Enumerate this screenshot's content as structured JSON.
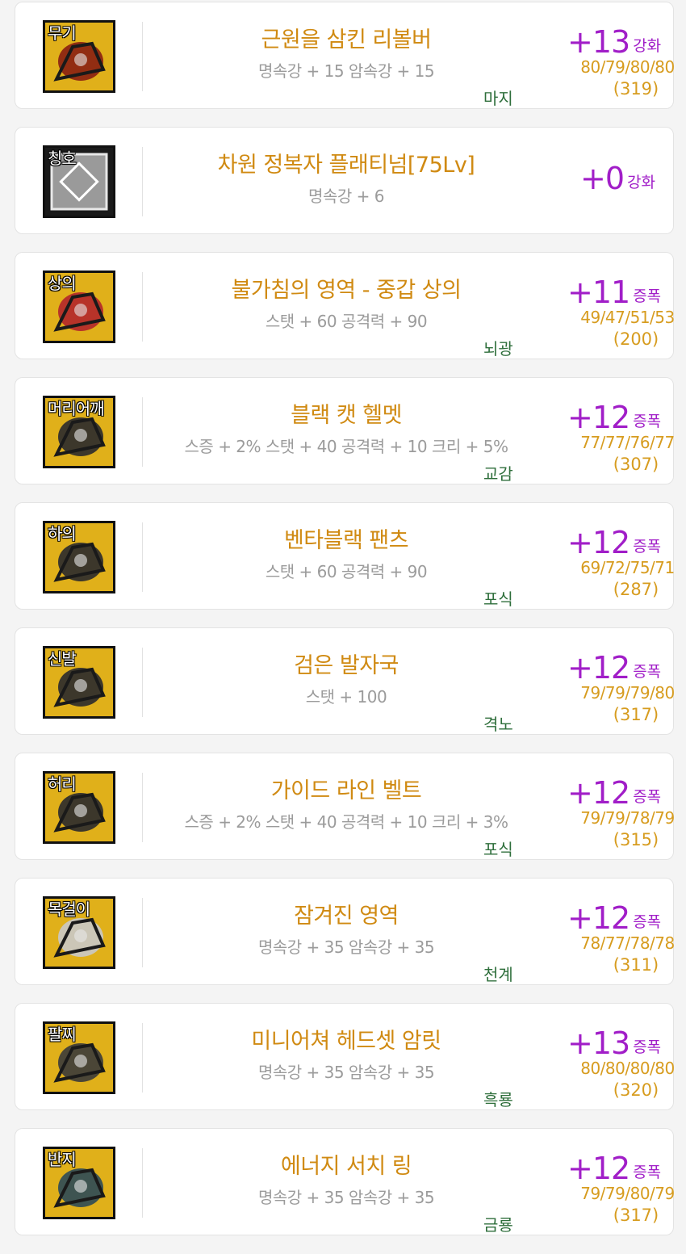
{
  "items": [
    {
      "slot": "무기",
      "name": "근원을 삼킨 리볼버",
      "stats": "명속강 + 15 암속강 + 15",
      "tag": "마지",
      "reinforce": "+13",
      "reinforce_type": "강화",
      "amp_values": "80/79/80/80",
      "total": "(319)",
      "icon": "revolver-icon",
      "art_color": "#8a1f12"
    },
    {
      "slot": "칭호",
      "name": "차원 정복자 플래티넘[75Lv]",
      "stats": "명속강 + 6",
      "tag": "",
      "reinforce": "+0",
      "reinforce_type": "강화",
      "amp_values": "",
      "total": "",
      "icon": "title-emblem-icon",
      "art_color": "#bdbdbd"
    },
    {
      "slot": "상의",
      "name": "불가침의 영역 - 중갑 상의",
      "stats": "스탯 + 60 공격력 + 90",
      "tag": "뇌광",
      "reinforce": "+11",
      "reinforce_type": "증폭",
      "amp_values": "49/47/51/53",
      "total": "(200)",
      "icon": "armor-top-icon",
      "art_color": "#b3262b"
    },
    {
      "slot": "머리어깨",
      "name": "블랙 캣 헬멧",
      "stats": "스증 + 2% 스탯 + 40 공격력 + 10 크리 + 5%",
      "tag": "교감",
      "reinforce": "+12",
      "reinforce_type": "증폭",
      "amp_values": "77/77/76/77",
      "total": "(307)",
      "icon": "helmet-icon",
      "art_color": "#2a2a2e"
    },
    {
      "slot": "하의",
      "name": "벤타블랙 팬츠",
      "stats": "스탯 + 60 공격력 + 90",
      "tag": "포식",
      "reinforce": "+12",
      "reinforce_type": "증폭",
      "amp_values": "69/72/75/71",
      "total": "(287)",
      "icon": "pants-icon",
      "art_color": "#2a2a2e"
    },
    {
      "slot": "신발",
      "name": "검은 발자국",
      "stats": "스탯 + 100",
      "tag": "격노",
      "reinforce": "+12",
      "reinforce_type": "증폭",
      "amp_values": "79/79/79/80",
      "total": "(317)",
      "icon": "boots-icon",
      "art_color": "#2a2a2e"
    },
    {
      "slot": "허리",
      "name": "가이드 라인 벨트",
      "stats": "스증 + 2% 스탯 + 40 공격력 + 10 크리 + 3%",
      "tag": "포식",
      "reinforce": "+12",
      "reinforce_type": "증폭",
      "amp_values": "79/79/78/79",
      "total": "(315)",
      "icon": "belt-icon",
      "art_color": "#2a2a2e"
    },
    {
      "slot": "목걸이",
      "name": "잠겨진 영역",
      "stats": "명속강 + 35 암속강 + 35",
      "tag": "천계",
      "reinforce": "+12",
      "reinforce_type": "증폭",
      "amp_values": "78/77/78/78",
      "total": "(311)",
      "icon": "necklace-icon",
      "art_color": "#c9c9c9"
    },
    {
      "slot": "팔찌",
      "name": "미니어쳐 헤드셋 암릿",
      "stats": "명속강 + 35 암속강 + 35",
      "tag": "흑룡",
      "reinforce": "+13",
      "reinforce_type": "증폭",
      "amp_values": "80/80/80/80",
      "total": "(320)",
      "icon": "headset-armlet-icon",
      "art_color": "#3b3b3b"
    },
    {
      "slot": "반지",
      "name": "에너지 서치 링",
      "stats": "명속강 + 35 암속강 + 35",
      "tag": "금룡",
      "reinforce": "+12",
      "reinforce_type": "증폭",
      "amp_values": "79/79/80/79",
      "total": "(317)",
      "icon": "ring-icon",
      "art_color": "#2c4a58"
    }
  ],
  "colors": {
    "item_name": "#d08a12",
    "stats": "#9b9b9b",
    "tag": "#2f6f3c",
    "reinforce": "#a11ec8",
    "amp": "#d79c1f",
    "icon_bg": "#e0b01a"
  }
}
